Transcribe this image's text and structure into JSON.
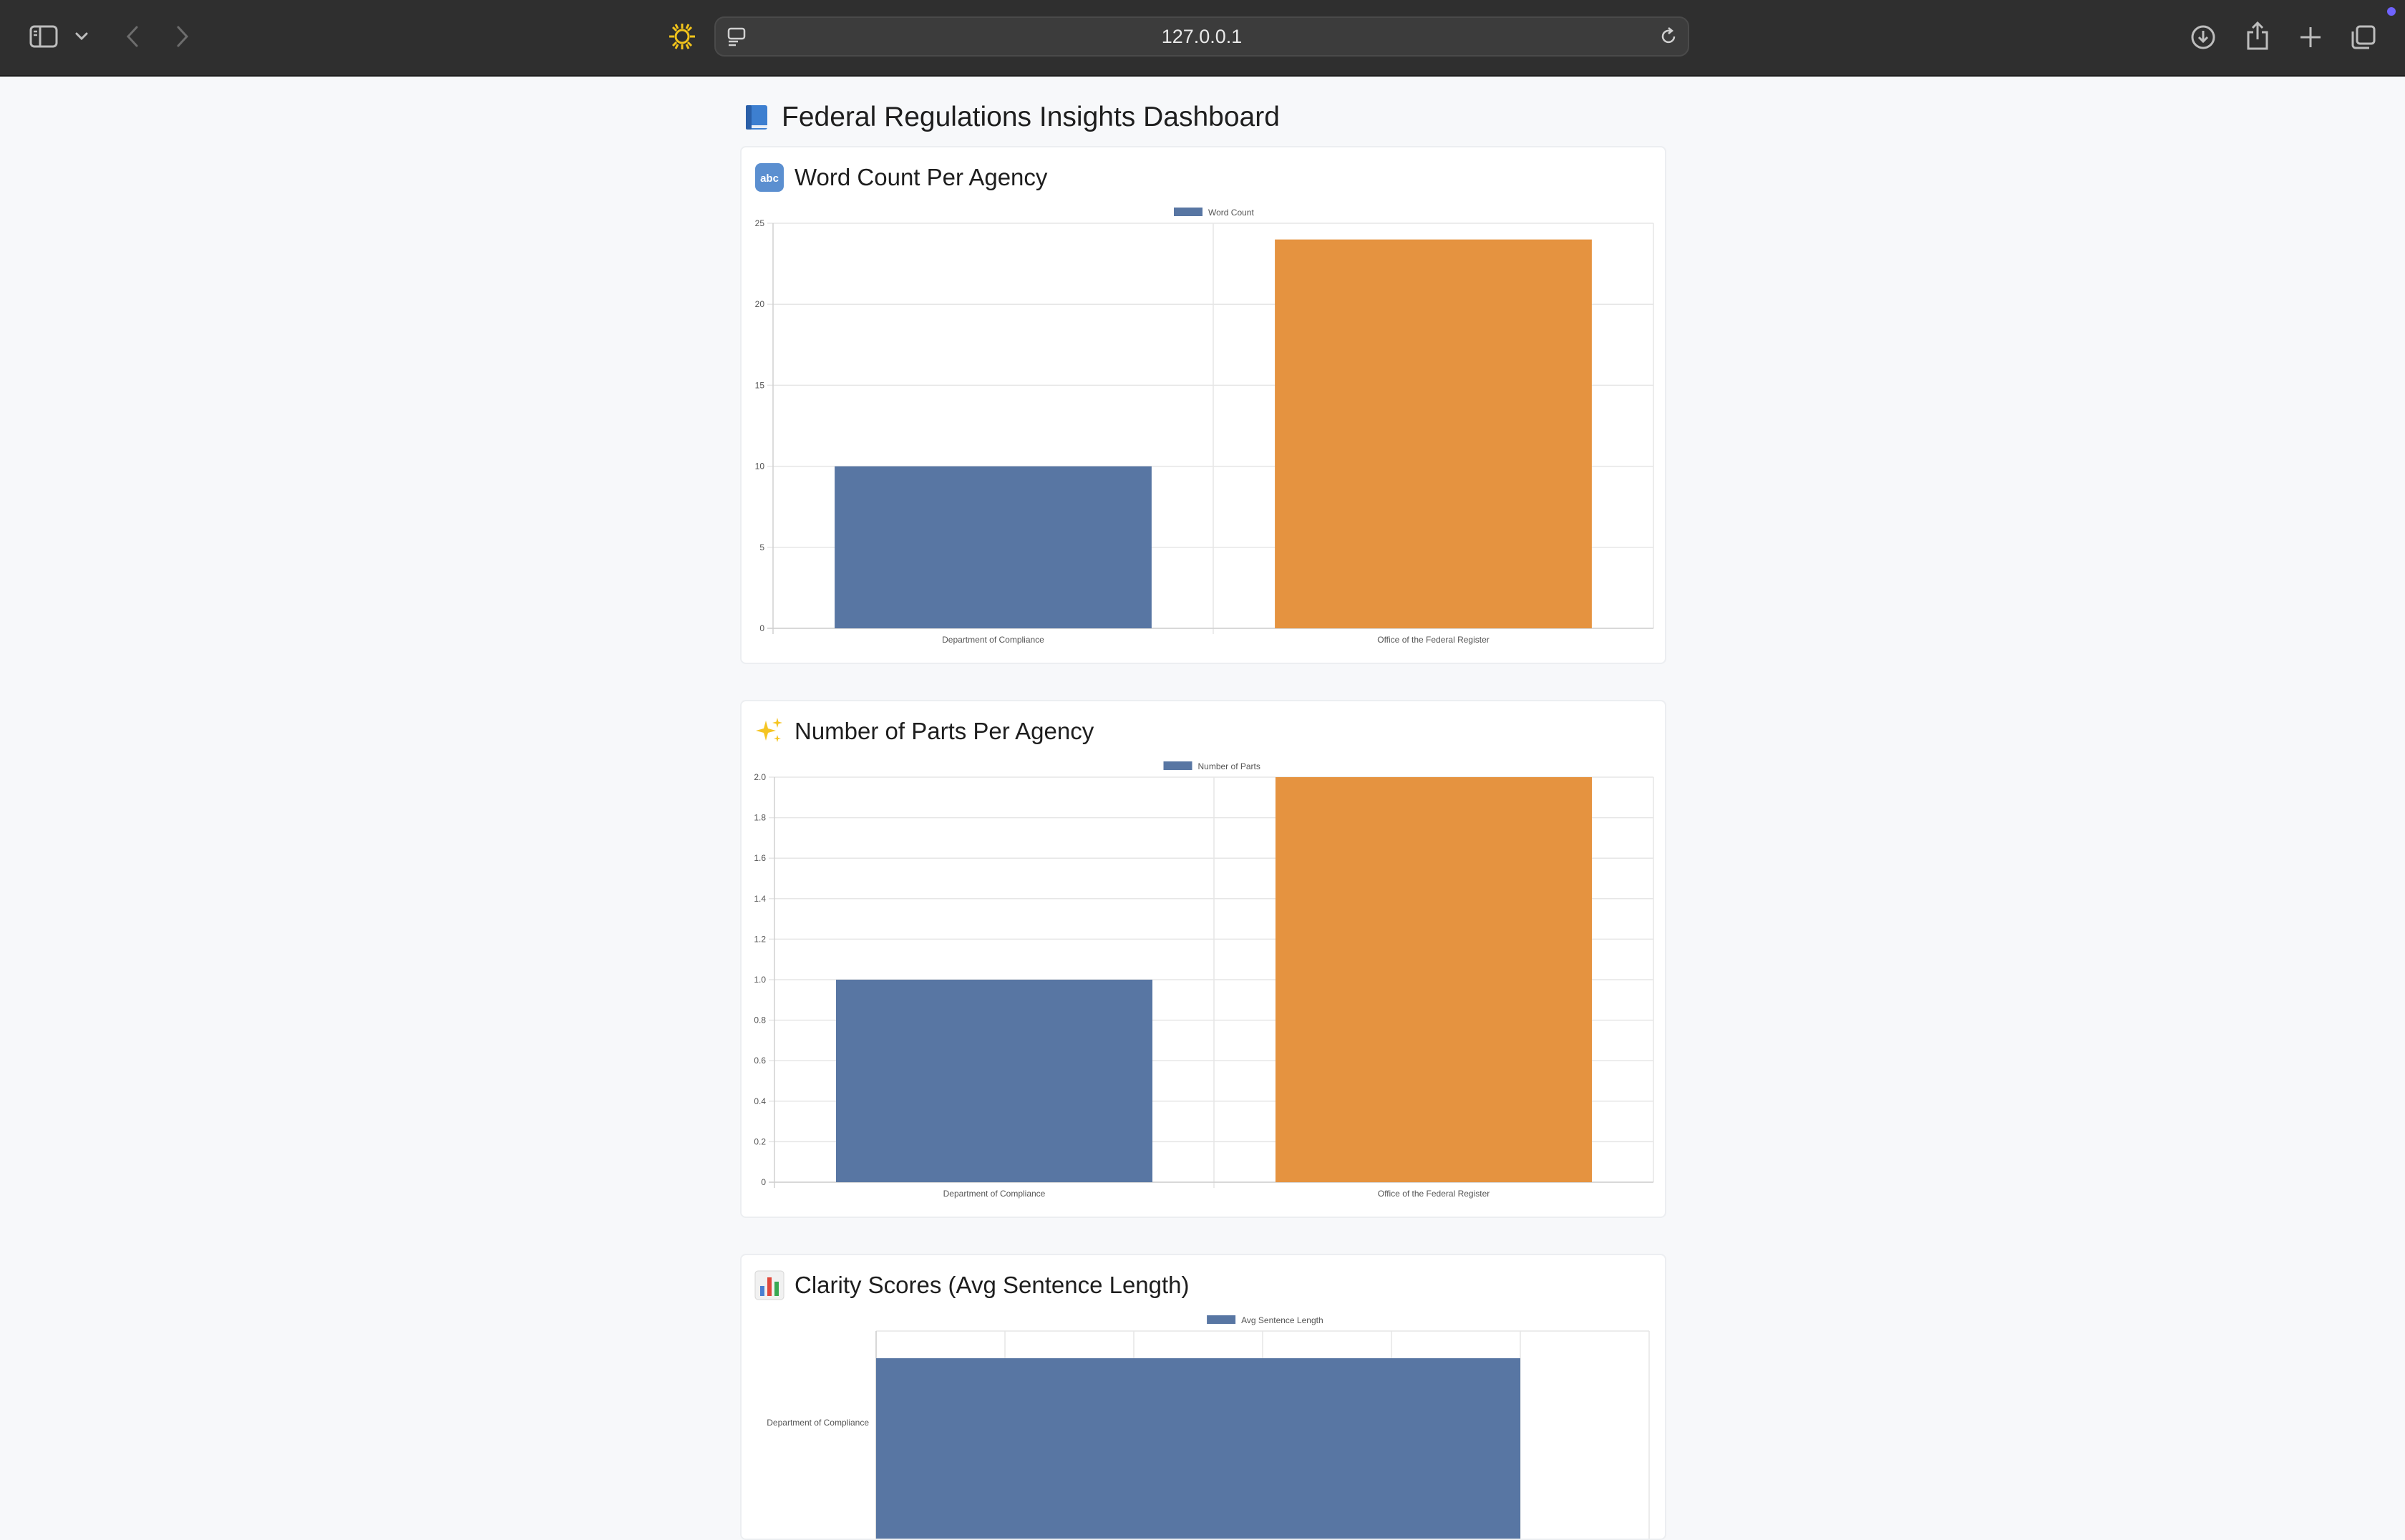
{
  "browser": {
    "url": "127.0.0.1",
    "icons": [
      "sidebar-icon",
      "chevron-down-icon",
      "back-icon",
      "forward-icon",
      "sun-icon",
      "page-menu-icon",
      "reload-icon",
      "download-icon",
      "share-icon",
      "plus-icon",
      "tabs-icon"
    ]
  },
  "page": {
    "title": "Federal Regulations Insights Dashboard",
    "title_icon": "blue-book-icon"
  },
  "cards": [
    {
      "title": "Word Count Per Agency",
      "icon": "abc-icon",
      "chart_data": {
        "type": "bar",
        "orientation": "vertical",
        "categories": [
          "Department of Compliance",
          "Office of the Federal Register"
        ],
        "series": [
          {
            "name": "Word Count",
            "values": [
              10,
              24
            ]
          }
        ],
        "bar_colors": [
          "#5876a3",
          "#e59340"
        ],
        "ylim": [
          0,
          25
        ],
        "yticks": [
          0,
          5,
          10,
          15,
          20,
          25
        ],
        "grid": true,
        "legend": "top-center"
      }
    },
    {
      "title": "Number of Parts Per Agency",
      "icon": "sparkles-icon",
      "chart_data": {
        "type": "bar",
        "orientation": "vertical",
        "categories": [
          "Department of Compliance",
          "Office of the Federal Register"
        ],
        "series": [
          {
            "name": "Number of Parts",
            "values": [
              1,
              2
            ]
          }
        ],
        "bar_colors": [
          "#5876a3",
          "#e59340"
        ],
        "ylim": [
          0,
          2
        ],
        "yticks": [
          "0",
          "0.2",
          "0.4",
          "0.6",
          "0.8",
          "1.0",
          "1.2",
          "1.4",
          "1.6",
          "1.8",
          "2.0"
        ],
        "grid": true,
        "legend": "top-center"
      }
    },
    {
      "title": "Clarity Scores (Avg Sentence Length)",
      "icon": "bar-chart-icon",
      "chart_data": {
        "type": "bar",
        "orientation": "horizontal",
        "categories": [
          "Department of Compliance"
        ],
        "series": [
          {
            "name": "Avg Sentence Length",
            "values": [
              5
            ]
          }
        ],
        "bar_colors": [
          "#5876a3"
        ],
        "xlim": [
          0,
          6
        ],
        "grid": true,
        "legend": "top-center"
      }
    }
  ]
}
